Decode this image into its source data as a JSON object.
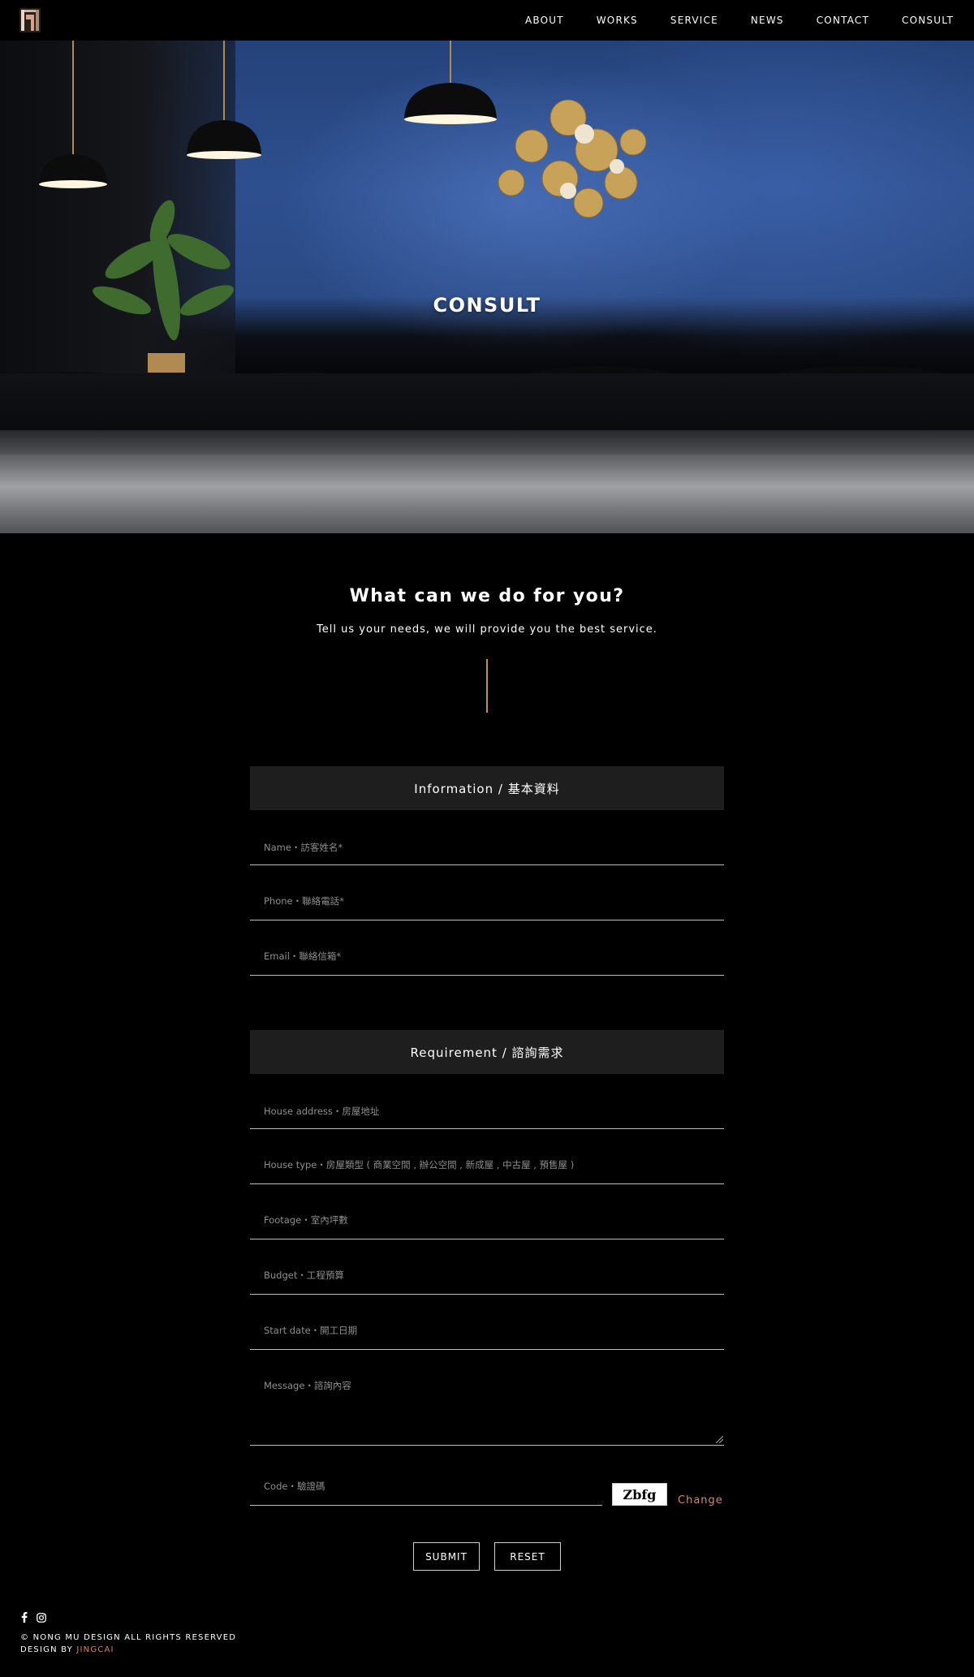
{
  "nav": {
    "items": [
      "ABOUT",
      "WORKS",
      "SERVICE",
      "NEWS",
      "CONTACT",
      "CONSULT"
    ]
  },
  "hero": {
    "title": "CONSULT"
  },
  "intro": {
    "heading": "What can we do for you?",
    "subheading": "Tell us your needs, we will provide you the best service."
  },
  "form": {
    "information": {
      "title": "Information / 基本資料",
      "fields": {
        "name": "Name・訪客姓名*",
        "phone": "Phone・聯絡電話*",
        "email": "Email・聯絡信箱*"
      }
    },
    "requirement": {
      "title": "Requirement / 諮詢需求",
      "fields": {
        "address": "House address・房屋地址",
        "house_type": "House type・房屋類型 ( 商業空間 , 辦公空間 , 新成屋 , 中古屋 , 預售屋 )",
        "footage": "Footage・室內坪數",
        "budget": "Budget・工程預算",
        "start_date": "Start date・開工日期",
        "message": "Message・諮詢內容"
      }
    },
    "code": {
      "placeholder": "Code・驗證碼",
      "captcha": "Zbfg",
      "change": "Change"
    },
    "submit": "SUBMIT",
    "reset": "RESET"
  },
  "footer": {
    "social": [
      "facebook-icon",
      "instagram-icon"
    ],
    "copyright": "© NONG MU DESIGN ALL RIGHTS RESERVED",
    "design_by": "DESIGN BY",
    "designer": "JINGCAI"
  },
  "colors": {
    "accent": "#d4876a",
    "section_bar": "#1e1e1e",
    "background": "#000000"
  }
}
